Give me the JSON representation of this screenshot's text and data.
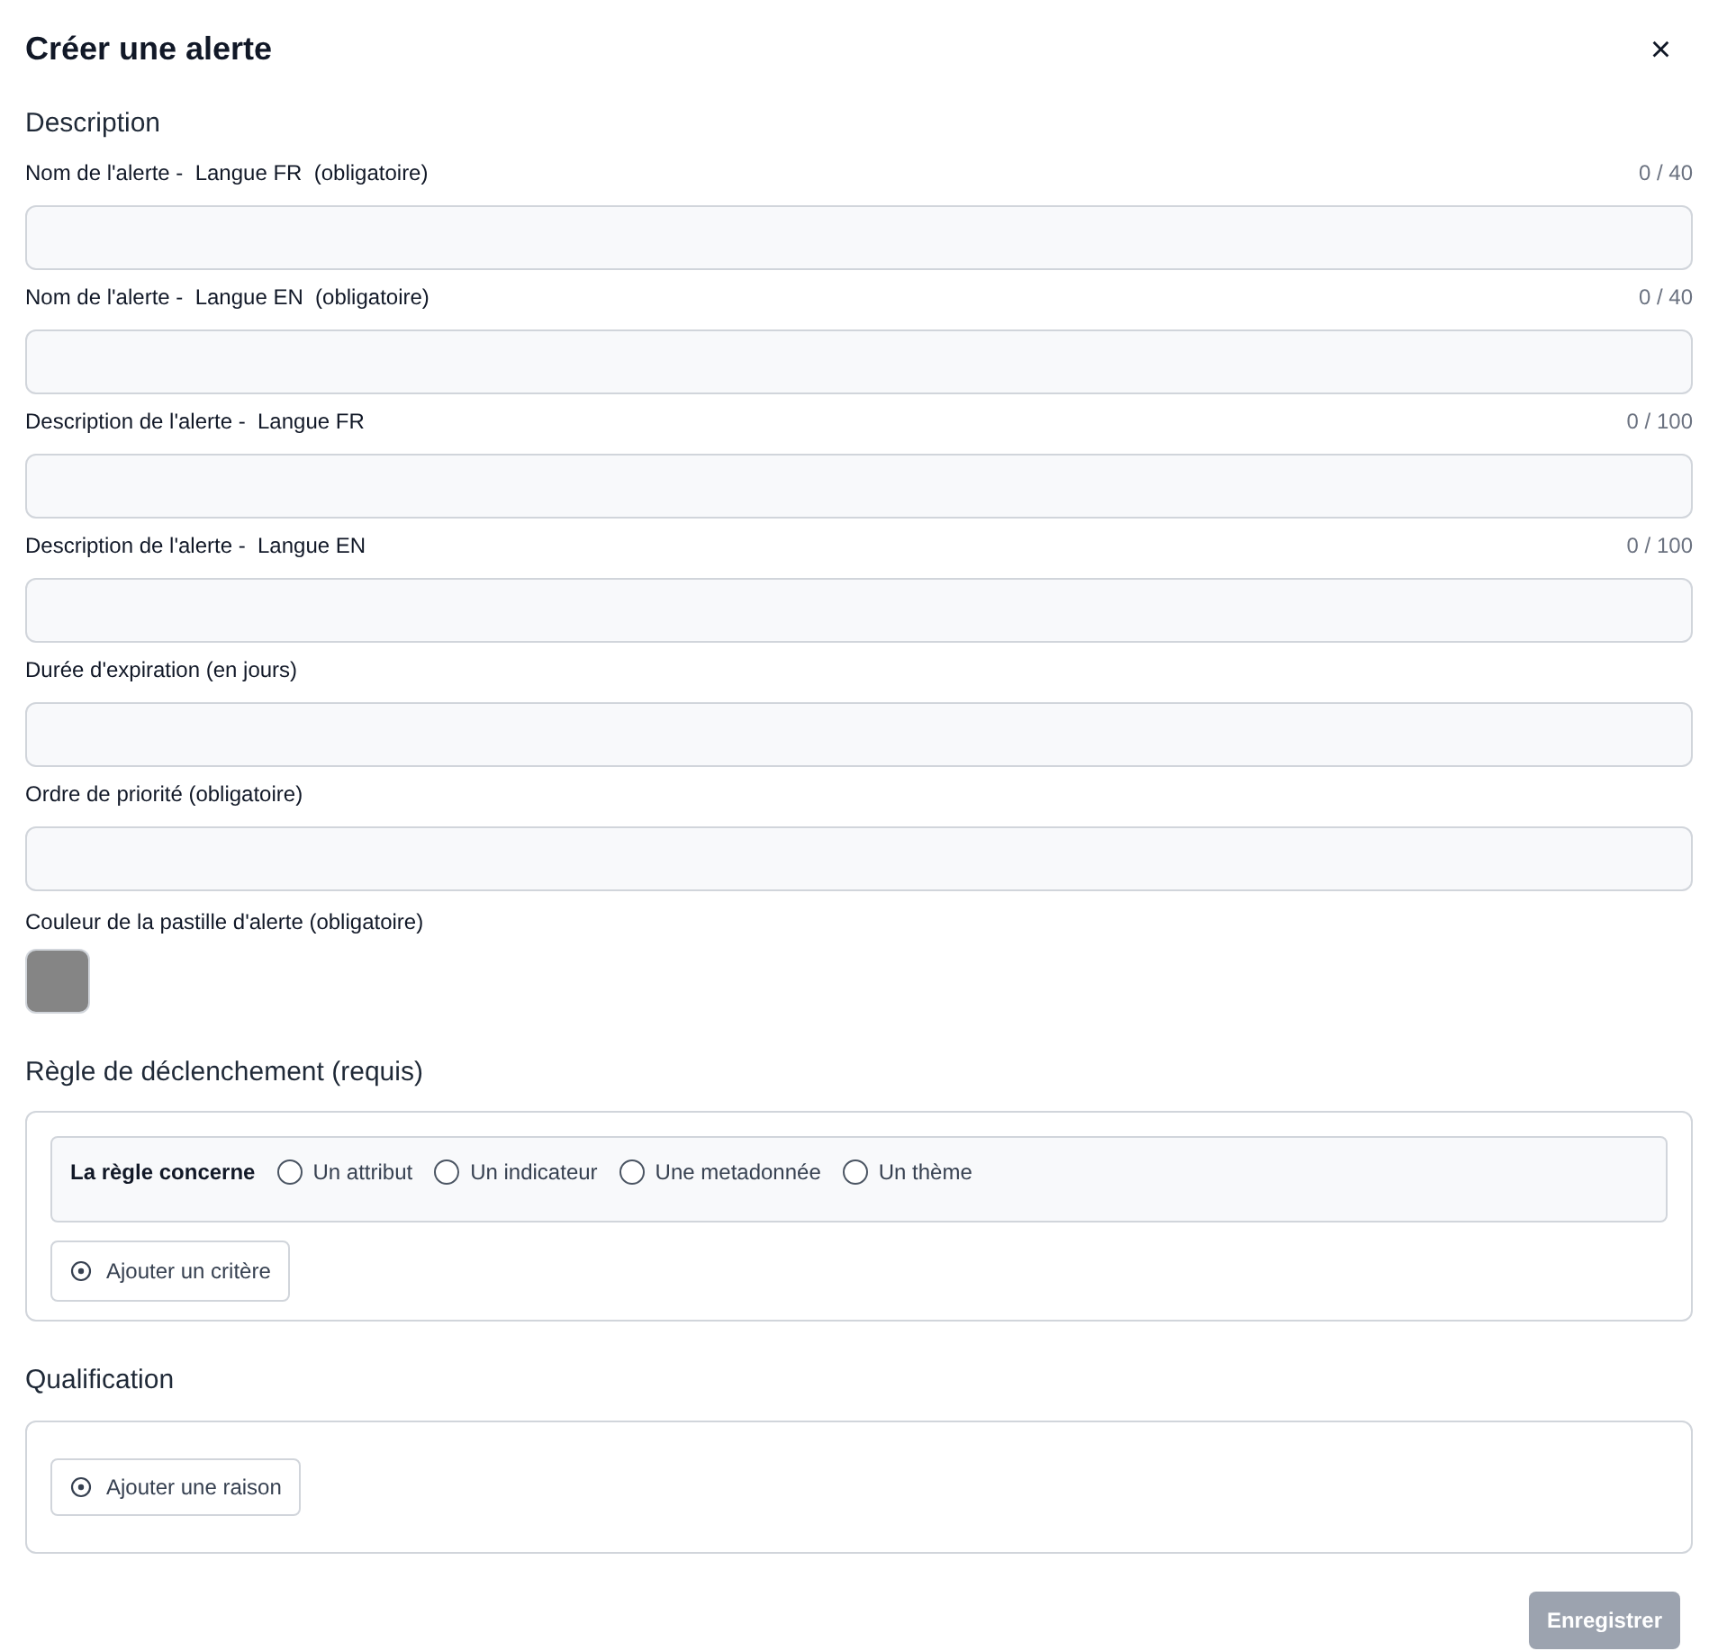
{
  "dialog": {
    "title": "Créer une alerte",
    "close": "×"
  },
  "description_section": {
    "heading": "Description",
    "fields": [
      {
        "label": "Nom de l'alerte -  Langue FR  (obligatoire)",
        "counter": "0 / 40"
      },
      {
        "label": "Nom de l'alerte -  Langue EN  (obligatoire)",
        "counter": "0 / 40"
      },
      {
        "label": "Description de l'alerte -  Langue FR",
        "counter": "0 / 100"
      },
      {
        "label": "Description de l'alerte -  Langue EN",
        "counter": "0 / 100"
      },
      {
        "label": "Durée d'expiration (en jours)"
      },
      {
        "label": "Ordre de priorité (obligatoire)"
      }
    ],
    "color_field": {
      "label": "Couleur de la pastille d'alerte (obligatoire)",
      "color": "#858585"
    }
  },
  "rule_section": {
    "heading": "Règle de déclenchement (requis)",
    "rule_label": "La règle concerne",
    "options": [
      {
        "label": "Un attribut",
        "selected": false
      },
      {
        "label": "Un indicateur",
        "selected": false
      },
      {
        "label": "Une metadonnée",
        "selected": false
      },
      {
        "label": "Un thème",
        "selected": false
      }
    ],
    "add_button": "Ajouter un critère"
  },
  "qualification_section": {
    "heading": "Qualification",
    "add_button": "Ajouter une raison"
  },
  "save_button": {
    "label": "Enregistrer",
    "disabled": true
  }
}
